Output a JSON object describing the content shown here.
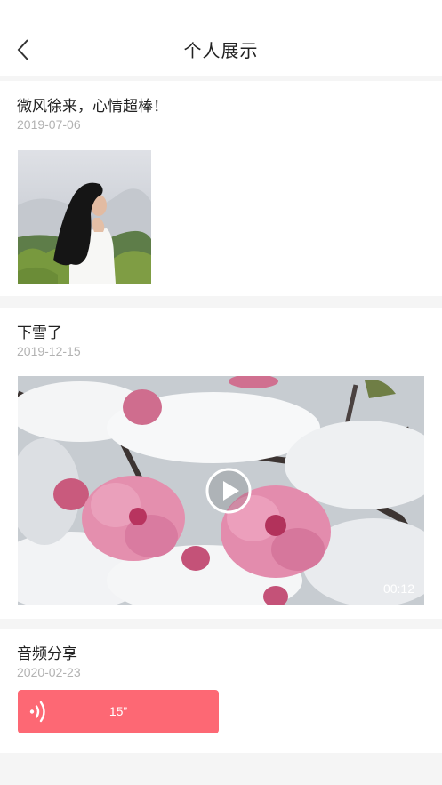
{
  "header": {
    "title": "个人展示",
    "back_icon": "chevron-left-icon"
  },
  "posts": [
    {
      "title": "微风徐来，心情超棒！",
      "date": "2019-07-06",
      "media": "photo"
    },
    {
      "title": "下雪了",
      "date": "2019-12-15",
      "media": "video",
      "duration": "00:12"
    },
    {
      "title": "音频分享",
      "date": "2020-02-23",
      "media": "audio",
      "duration": "15”"
    }
  ],
  "colors": {
    "accent": "#fd6874",
    "background": "#f5f5f5",
    "card": "#ffffff",
    "date_text": "#b2b2b2"
  }
}
